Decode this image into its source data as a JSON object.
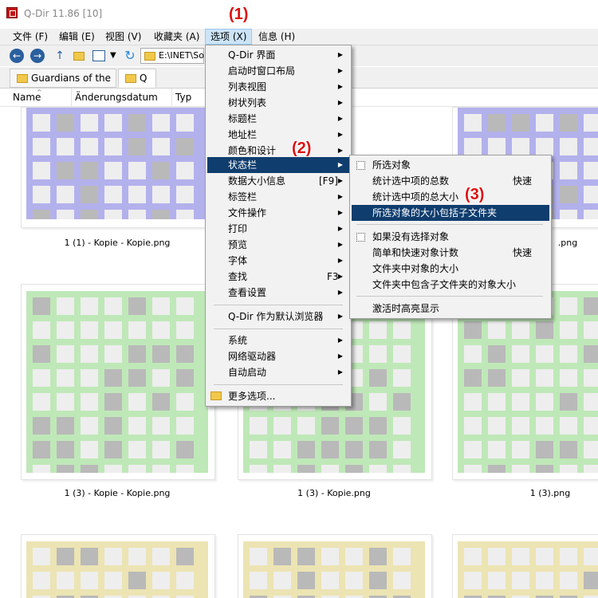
{
  "window": {
    "title": "Q-Dir 11.86 [10]"
  },
  "annotations": {
    "one": "(1)",
    "two": "(2)",
    "three": "(3)"
  },
  "menubar": {
    "file": "文件 (F)",
    "edit": "编辑 (E)",
    "view": "视图 (V)",
    "favorites": "收藏夹 (A)",
    "options": "选项 (X)",
    "info": "信息 (H)"
  },
  "toolbar": {
    "address": "E:\\INET\\So",
    "back_icon": "back-arrow-icon",
    "forward_icon": "forward-arrow-icon",
    "refresh_icon": "refresh-icon"
  },
  "tabs": [
    {
      "label": "Guardians of the"
    },
    {
      "label": "Q"
    }
  ],
  "columns": {
    "name": "Name",
    "date": "Änderungsdatum",
    "type": "Typ"
  },
  "files": {
    "r1c1": "1 (1) - Kopie - Kopie.png",
    "r1c4": ".png",
    "r2c1": "1 (3) - Kopie - Kopie.png",
    "r2c2": "1 (3) - Kopie.png",
    "r2c4": "1 (3).png"
  },
  "colors": {
    "blue_grid": "#b3b1ec",
    "green_grid": "#bfe8b8",
    "yellow_grid": "#ece4b3",
    "accent": "#0f3d6e",
    "annotation": "#d11111"
  },
  "options_menu": {
    "items": [
      {
        "label": "Q-Dir 界面",
        "shortcut": "",
        "submenu": true
      },
      {
        "label": "启动时窗口布局",
        "shortcut": "",
        "submenu": true
      },
      {
        "label": "列表视图",
        "shortcut": "",
        "submenu": true
      },
      {
        "label": "树状列表",
        "shortcut": "",
        "submenu": true
      },
      {
        "label": "标题栏",
        "shortcut": "",
        "submenu": true
      },
      {
        "label": "地址栏",
        "shortcut": "",
        "submenu": true
      },
      {
        "label": "颜色和设计",
        "shortcut": "",
        "submenu": true
      },
      {
        "label": "状态栏",
        "shortcut": "",
        "submenu": true
      },
      {
        "label": "数据大小信息",
        "shortcut": "[F9]",
        "submenu": true
      },
      {
        "label": "标签栏",
        "shortcut": "",
        "submenu": true
      },
      {
        "label": "文件操作",
        "shortcut": "",
        "submenu": true
      },
      {
        "label": "打印",
        "shortcut": "",
        "submenu": true
      },
      {
        "label": "预览",
        "shortcut": "",
        "submenu": true
      },
      {
        "label": "字体",
        "shortcut": "",
        "submenu": true
      },
      {
        "label": "查找",
        "shortcut": "F3",
        "submenu": true
      },
      {
        "label": "查看设置",
        "shortcut": "",
        "submenu": true
      },
      {
        "label": "Q-Dir 作为默认浏览器",
        "shortcut": "",
        "submenu": true
      },
      {
        "label": "系统",
        "shortcut": "",
        "submenu": true
      },
      {
        "label": "网络驱动器",
        "shortcut": "",
        "submenu": true
      },
      {
        "label": "自动启动",
        "shortcut": "",
        "submenu": true
      },
      {
        "label": "更多选项...",
        "shortcut": "",
        "submenu": false
      }
    ]
  },
  "status_submenu": {
    "items": [
      {
        "label": "所选对象",
        "shortcut": ""
      },
      {
        "label": "统计选中项的总数",
        "shortcut": "快速"
      },
      {
        "label": "统计选中项的总大小",
        "shortcut": ""
      },
      {
        "label": "所选对象的大小包括子文件夹",
        "shortcut": ""
      },
      {
        "label": "如果没有选择对象",
        "shortcut": ""
      },
      {
        "label": "简单和快速对象计数",
        "shortcut": "快速"
      },
      {
        "label": "文件夹中对象的大小",
        "shortcut": ""
      },
      {
        "label": "文件夹中包含子文件夹的对象大小",
        "shortcut": ""
      },
      {
        "label": "激活时高亮显示",
        "shortcut": ""
      }
    ]
  }
}
